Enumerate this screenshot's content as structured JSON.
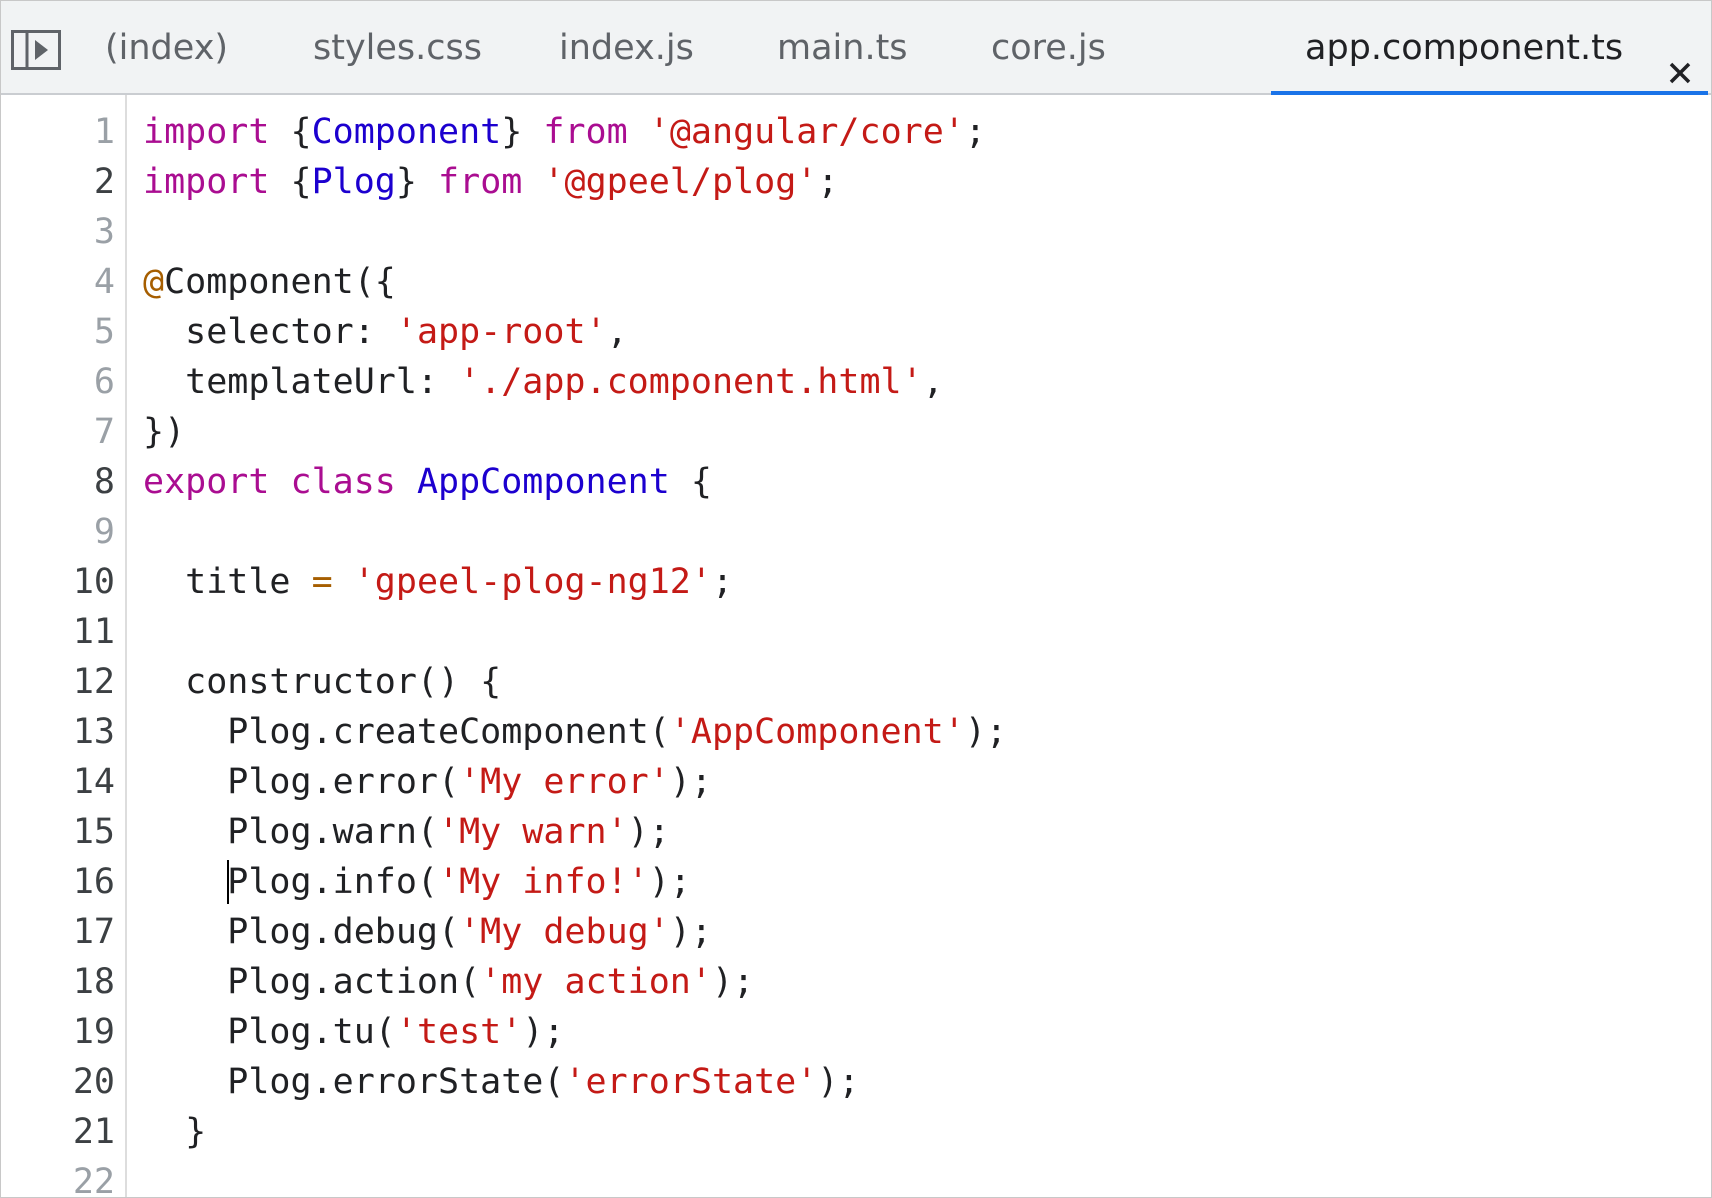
{
  "colors": {
    "keyword": "#aa0d91",
    "string": "#c41a16",
    "type_name": "#1c00cf",
    "decorator": "#a65e00",
    "plain": "#202124",
    "line_number": "#9aa0a6",
    "active_tab_indicator": "#1a73e8",
    "tabbar_background": "#f1f3f4"
  },
  "tabs": [
    {
      "label": "(index)",
      "active": false
    },
    {
      "label": "styles.css",
      "active": false
    },
    {
      "label": "index.js",
      "active": false
    },
    {
      "label": "main.ts",
      "active": false
    },
    {
      "label": "core.js",
      "active": false
    },
    {
      "label": "app.component.ts",
      "active": true
    }
  ],
  "icons": {
    "sidebar_toggle": "sidebar-toggle-icon",
    "close": "close-icon"
  },
  "editor": {
    "caret_line": 16,
    "lines": [
      {
        "number": "1",
        "tokens": [
          [
            "kw",
            "import"
          ],
          [
            "p",
            " {"
          ],
          [
            "def",
            "Component"
          ],
          [
            "p",
            "} "
          ],
          [
            "kw",
            "from"
          ],
          [
            "p",
            " "
          ],
          [
            "str",
            "'@angular/core'"
          ],
          [
            "p",
            ";"
          ]
        ]
      },
      {
        "number": "2",
        "tokens": [
          [
            "kw",
            "import"
          ],
          [
            "p",
            " {"
          ],
          [
            "def",
            "Plog"
          ],
          [
            "p",
            "} "
          ],
          [
            "kw",
            "from"
          ],
          [
            "p",
            " "
          ],
          [
            "str",
            "'@gpeel/plog'"
          ],
          [
            "p",
            ";"
          ]
        ]
      },
      {
        "number": "3",
        "tokens": []
      },
      {
        "number": "4",
        "tokens": [
          [
            "at",
            "@"
          ],
          [
            "p",
            "Component({"
          ]
        ]
      },
      {
        "number": "5",
        "tokens": [
          [
            "p",
            "  selector: "
          ],
          [
            "str",
            "'app-root'"
          ],
          [
            "p",
            ","
          ]
        ]
      },
      {
        "number": "6",
        "tokens": [
          [
            "p",
            "  templateUrl: "
          ],
          [
            "str",
            "'./app.component.html'"
          ],
          [
            "p",
            ","
          ]
        ]
      },
      {
        "number": "7",
        "tokens": [
          [
            "p",
            "})"
          ]
        ]
      },
      {
        "number": "8",
        "tokens": [
          [
            "kw",
            "export"
          ],
          [
            "p",
            " "
          ],
          [
            "kw",
            "class"
          ],
          [
            "p",
            " "
          ],
          [
            "def",
            "AppComponent"
          ],
          [
            "p",
            " {"
          ]
        ]
      },
      {
        "number": "9",
        "tokens": []
      },
      {
        "number": "10",
        "tokens": [
          [
            "p",
            "  title "
          ],
          [
            "at",
            "="
          ],
          [
            "p",
            " "
          ],
          [
            "str",
            "'gpeel-plog-ng12'"
          ],
          [
            "p",
            ";"
          ]
        ]
      },
      {
        "number": "11",
        "tokens": []
      },
      {
        "number": "12",
        "tokens": [
          [
            "p",
            "  constructor() {"
          ]
        ]
      },
      {
        "number": "13",
        "tokens": [
          [
            "p",
            "    Plog.createComponent("
          ],
          [
            "str",
            "'AppComponent'"
          ],
          [
            "p",
            ");"
          ]
        ]
      },
      {
        "number": "14",
        "tokens": [
          [
            "p",
            "    Plog.error("
          ],
          [
            "str",
            "'My error'"
          ],
          [
            "p",
            ");"
          ]
        ]
      },
      {
        "number": "15",
        "tokens": [
          [
            "p",
            "    Plog.warn("
          ],
          [
            "str",
            "'My warn'"
          ],
          [
            "p",
            ");"
          ]
        ]
      },
      {
        "number": "16",
        "tokens": [
          [
            "p",
            "    Plog.info("
          ],
          [
            "str",
            "'My info!'"
          ],
          [
            "p",
            ");"
          ]
        ]
      },
      {
        "number": "17",
        "tokens": [
          [
            "p",
            "    Plog.debug("
          ],
          [
            "str",
            "'My debug'"
          ],
          [
            "p",
            ");"
          ]
        ]
      },
      {
        "number": "18",
        "tokens": [
          [
            "p",
            "    Plog.action("
          ],
          [
            "str",
            "'my action'"
          ],
          [
            "p",
            ");"
          ]
        ]
      },
      {
        "number": "19",
        "tokens": [
          [
            "p",
            "    Plog.tu("
          ],
          [
            "str",
            "'test'"
          ],
          [
            "p",
            ");"
          ]
        ]
      },
      {
        "number": "20",
        "tokens": [
          [
            "p",
            "    Plog.errorState("
          ],
          [
            "str",
            "'errorState'"
          ],
          [
            "p",
            ");"
          ]
        ]
      },
      {
        "number": "21",
        "tokens": [
          [
            "p",
            "  }"
          ]
        ]
      },
      {
        "number": "22",
        "tokens": []
      }
    ]
  }
}
